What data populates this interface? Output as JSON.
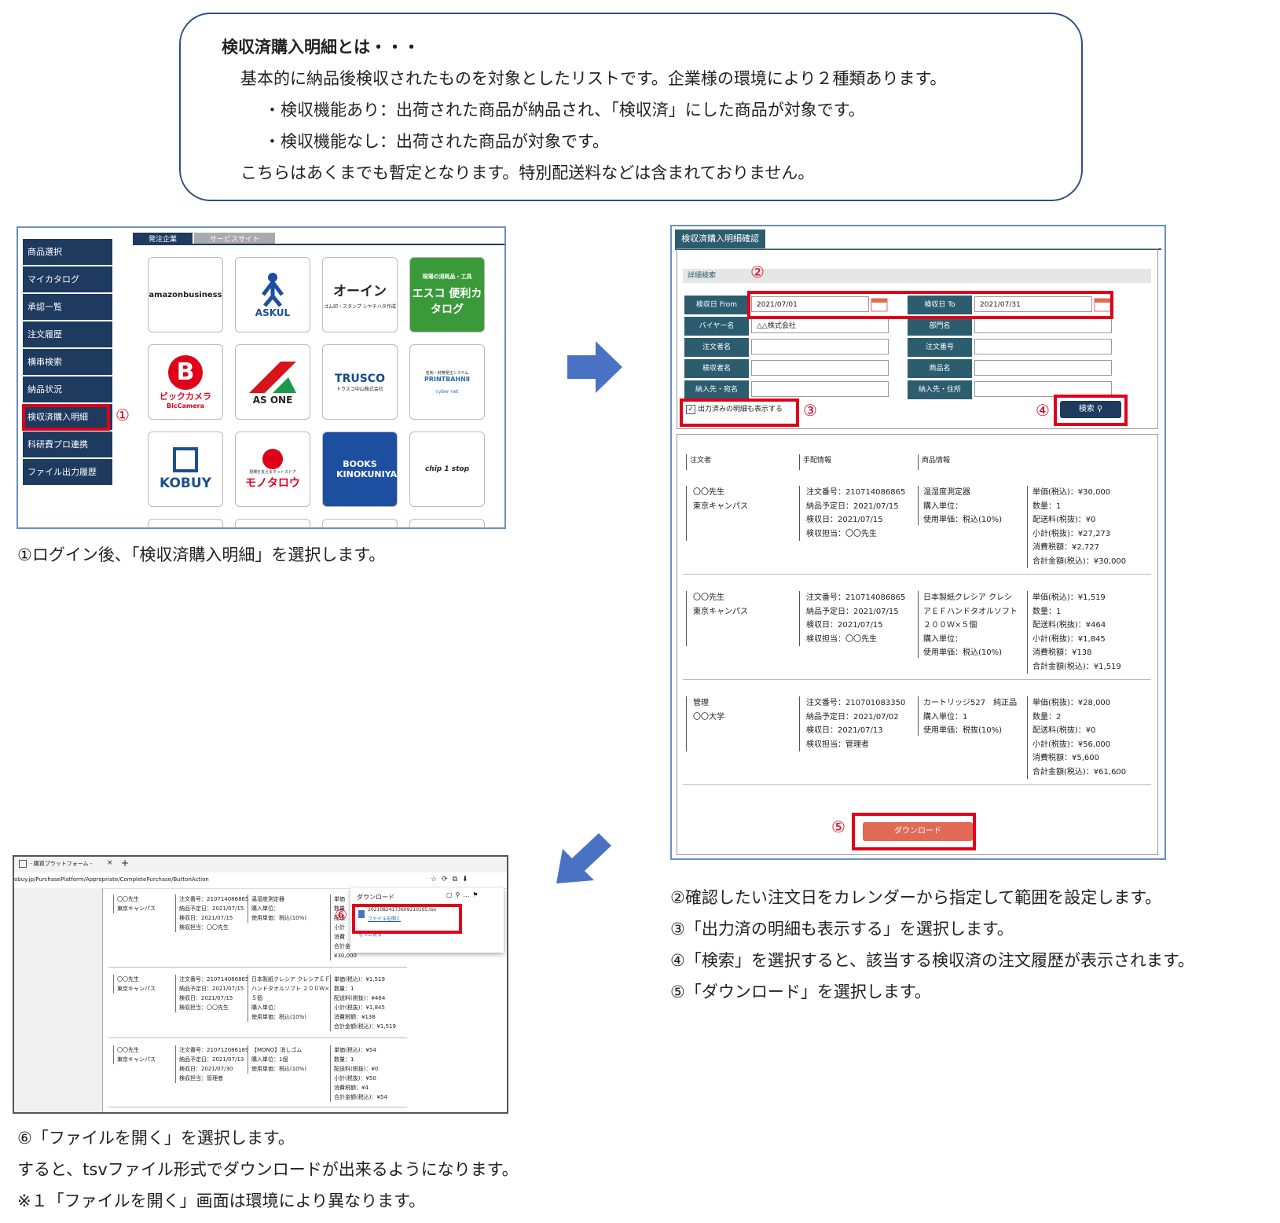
{
  "intro": {
    "title": "検収済購入明細とは・・・",
    "line1": "基本的に納品後検収されたものを対象としたリストです。企業様の環境により２種類あります。",
    "line2": "・検収機能あり：出荷された商品が納品され、「検収済」にした商品が対象です。",
    "line3": "・検収機能なし：出荷された商品が対象です。",
    "line4": "こちらはあくまでも暫定となります。特別配送料などは含まれておりません。"
  },
  "panel1": {
    "menu": [
      "商品選択",
      "マイカタログ",
      "承認一覧",
      "注文履歴",
      "横串検索",
      "納品状況",
      "検収済購入明細",
      "科研費プロ連携",
      "ファイル出力履歴"
    ],
    "tabs": [
      "発注企業",
      "サービスサイト"
    ],
    "tiles": [
      "amazonbusiness",
      "ASKUL",
      "オーイン",
      "エスコ 便利カタログ",
      "ビックカメラ",
      "AS ONE",
      "TRUSCO",
      "PRINTBAHNⅡ",
      "KOBUY",
      "モノタロウ",
      "BOOKS KINOKUNIYA",
      "chip 1 stop"
    ],
    "tile_subs": {
      "oin": "ゴム印・スタンプ シヤチハタ作成",
      "esco_top": "現場の消耗品・工具",
      "bic": "BicCamera",
      "trusco": "トラスコ中山株式会社",
      "printbahn": "名刺・封筒発注システム",
      "cybernet": "cyber net",
      "monotaro": "現場を支えるネットストア"
    },
    "caption": "①ログイン後、「検収済購入明細」を選択します。"
  },
  "panel2": {
    "tab": "検収済購入明細確認",
    "section": "詳細検索",
    "labels": {
      "from": "検収日 From",
      "to": "検収日 To",
      "buyer": "バイヤー名",
      "dept": "部門名",
      "orderer": "注文者名",
      "order_no": "注文番号",
      "inspector": "検収者名",
      "product": "商品名",
      "dest_name": "納入先・宛名",
      "dest_addr": "納入先・住所"
    },
    "values": {
      "from": "2021/07/01",
      "to": "2021/07/31",
      "buyer": "△△株式会社"
    },
    "checkbox": "出力済みの明細も表示する",
    "search": "検索",
    "columns": [
      "注文者",
      "手配情報",
      "商品情報"
    ],
    "rows": [
      {
        "orderer": "〇〇先生\n東京キャンパス",
        "arrange": "注文番号：210714086865\n納品予定日：2021/07/15\n検収日：2021/07/15\n検収担当：〇〇先生",
        "product": "温湿度測定器\n購入単位：\n使用単価：税込(10%)",
        "amount": "単価(税込)：¥30,000\n数量：1\n配送料(税抜)：¥0\n小計(税抜)：¥27,273\n消費税額：¥2,727\n合計金額(税込)：¥30,000"
      },
      {
        "orderer": "〇〇先生\n東京キャンパス",
        "arrange": "注文番号：210714086865\n納品予定日：2021/07/15\n検収日：2021/07/15\n検収担当：〇〇先生",
        "product": "日本製紙クレシア クレシ\nアＥＦハンドタオルソフト\n２００Ｗ×５個\n購入単位：\n使用単価：税込(10%)",
        "amount": "単価(税込)：¥1,519\n数量：1\n配送料(税抜)：¥464\n小計(税抜)：¥1,845\n消費税額：¥138\n合計金額(税込)：¥1,519"
      },
      {
        "orderer": "管理\n〇〇大学",
        "arrange": "注文番号：210701083350\n納品予定日：2021/07/02\n検収日：2021/07/13\n検収担当：管理者",
        "product": "カートリッジ527　純正品\n購入単位：1\n使用単価：税抜(10%)",
        "amount": "単価(税抜)：¥28,000\n数量：2\n配送料(税抜)：¥0\n小計(税抜)：¥56,000\n消費税額：¥5,600\n合計金額(税込)：¥61,600"
      }
    ],
    "download": "ダウンロード"
  },
  "panel3": {
    "tab_title": "- 購買プラットフォーム -",
    "url": "obuy.jp/PurchasePlatform/Appropriate/CompletePurchase/ButtonAction",
    "downloads_title": "ダウンロード",
    "file_name": "20210824173609210105.tsv",
    "open_file": "ファイルを開く",
    "more": "もっと見る",
    "rows": [
      {
        "orderer": "〇〇先生\n東京キャンパス",
        "arrange": "注文番号：210714086865\n納品予定日：2021/07/15\n検収日：2021/07/15\n検収担当：〇〇先生",
        "product": "温湿度測定器\n購入単位：\n使用単価：税込(10%)",
        "amount": "単価\n数量\n配送\n小計\n消費\n合計金額(税込)：\n¥30,000"
      },
      {
        "orderer": "〇〇先生\n東京キャンパス",
        "arrange": "注文番号：210714086865\n納品予定日：2021/07/15\n検収日：2021/07/15\n検収担当：〇〇先生",
        "product": "日本製紙クレシア クレシアＥＦ\nハンドタオルソフト ２００Ｗ×\n５個\n購入単位：\n使用単価：税込(10%)",
        "amount": "単価(税込)：¥1,519\n数量：1\n配送料(税抜)：¥464\n小計(税抜)：¥1,845\n消費税額：¥138\n合計金額(税込)：¥1,519"
      },
      {
        "orderer": "〇〇先生\n東京キャンパス",
        "arrange": "注文番号：210712086189\n納品予定日：2021/07/13\n検収日：2021/07/30\n検収担当：管理者",
        "product": "【MONO】消しゴム\n購入単位：1個\n使用単価：税込(10%)",
        "amount": "単価(税込)：¥54\n数量：1\n配送料(税抜)：¥0\n小計(税抜)：¥50\n消費税額：¥4\n合計金額(税込)：¥54"
      }
    ]
  },
  "markers": [
    "①",
    "②",
    "③",
    "④",
    "⑤",
    "⑥"
  ],
  "captions": {
    "c2": "②確認したい注文日をカレンダーから指定して範囲を設定します。",
    "c3": "③「出力済の明細も表示する」を選択します。",
    "c4": "④「検索」を選択すると、該当する検収済の注文履歴が表示されます。",
    "c5": "⑤「ダウンロード」を選択します。",
    "c6": "⑥「ファイルを開く」を選択します。",
    "c7": "すると、tsvファイル形式でダウンロードが出来るようになります。",
    "c8": "※１「ファイルを開く」画面は環境により異なります。"
  },
  "colors": {
    "navy": "#1e3a5f",
    "red": "#e0001a",
    "arrow": "#4a72c4",
    "download": "#e06a55"
  }
}
